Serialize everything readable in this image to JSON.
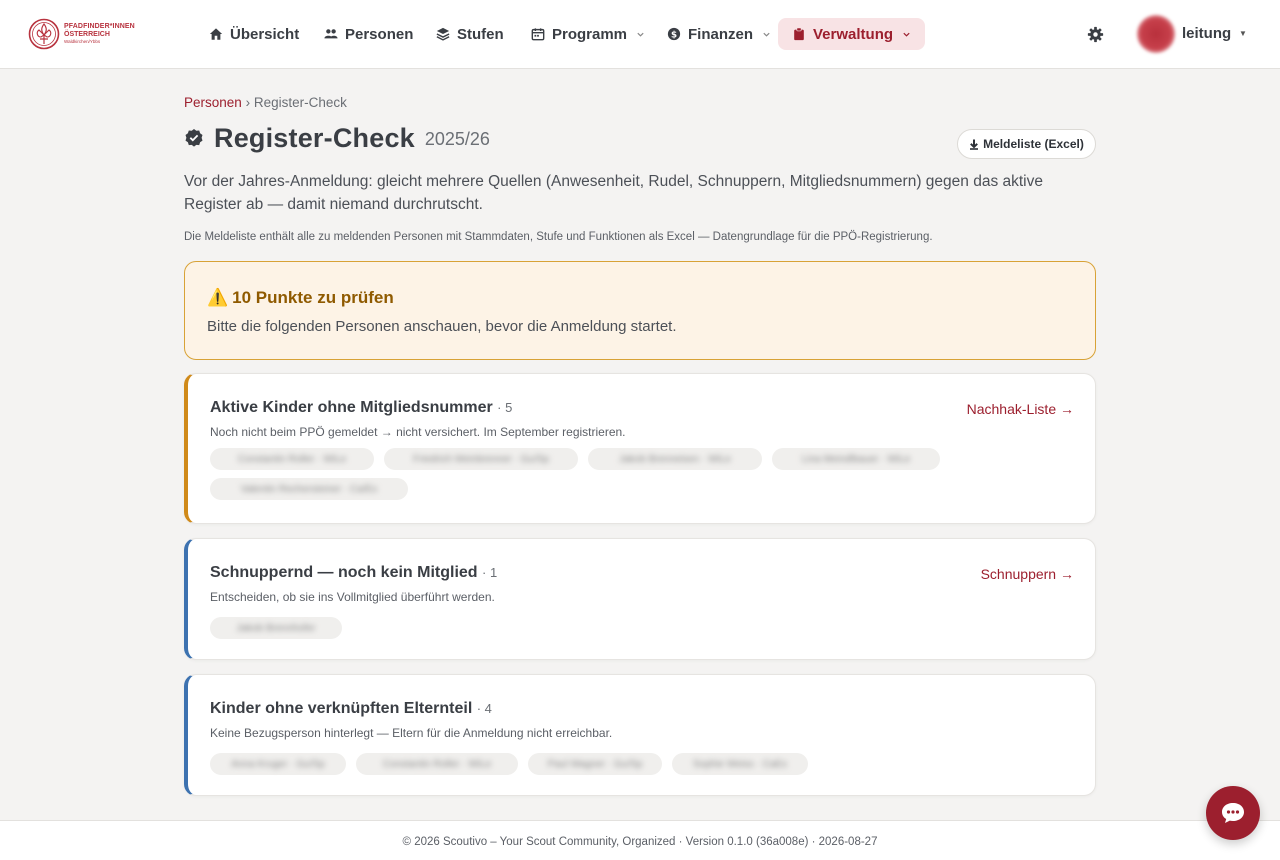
{
  "brand": {
    "line1": "PFADFINDER*INNEN",
    "line2": "ÖSTERREICH",
    "line3": "Waldkirchen/Ybbs",
    "color": "#b8333f"
  },
  "nav": {
    "items": [
      {
        "label": "Übersicht",
        "icon": "home-icon"
      },
      {
        "label": "Personen",
        "icon": "people-icon"
      },
      {
        "label": "Stufen",
        "icon": "layers-icon"
      },
      {
        "label": "Programm",
        "icon": "calendar-icon"
      },
      {
        "label": "Finanzen",
        "icon": "dollar-icon"
      },
      {
        "label": "Verwaltung",
        "icon": "clipboard-icon",
        "active": true
      }
    ],
    "user": "leitung",
    "accent": "#9c1f2e"
  },
  "breadcrumb": {
    "parent": "Personen",
    "separator": "›",
    "current": "Register-Check"
  },
  "page": {
    "title": "Register-Check",
    "year": "2025/26",
    "excel_button": "Meldeliste (Excel)",
    "intro": "Vor der Jahres-Anmeldung: gleicht mehrere Quellen (Anwesenheit, Rudel, Schnuppern, Mitgliedsnummern) gegen das aktive Register ab — damit niemand durchrutscht.",
    "note": "Die Meldeliste enthält alle zu meldenden Personen mit Stammdaten, Stufe und Funktionen als Excel — Datengrundlage für die PPÖ-Registrierung."
  },
  "alert": {
    "icon": "⚠️",
    "title": "10 Punkte zu prüfen",
    "text": "Bitte die folgenden Personen anschauen, bevor die Anmeldung startet."
  },
  "cards": [
    {
      "title": "Aktive Kinder ohne Mitgliedsnummer",
      "count": "· 5",
      "desc": "Noch nicht beim PPÖ gemeldet → nicht versichert. Im September registrieren.",
      "link": "Nachhak-Liste →",
      "accent": "#d08a1a",
      "chips": [
        "Constantin Roller · WiLe",
        "Friedrich Weinbrenner · Gu/Sp",
        "Jakob Brenneisen · WiLe",
        "Lina Meindlbauer · WiLe",
        "Valentin Rechersteiner · Ca/Ex"
      ]
    },
    {
      "title": "Schnuppernd — noch kein Mitglied",
      "count": "· 1",
      "desc": "Entscheiden, ob sie ins Vollmitglied überführt werden.",
      "link": "Schnuppern →",
      "accent": "#3d72b0",
      "chips": [
        "Jakob Brennhofer"
      ]
    },
    {
      "title": "Kinder ohne verknüpften Elternteil",
      "count": "· 4",
      "desc": "Keine Bezugsperson hinterlegt — Eltern für die Anmeldung nicht erreichbar.",
      "link": "",
      "accent": "#3d72b0",
      "chips": [
        "Anna Kruger · Gu/Sp",
        "Constantin Roller · WiLe",
        "Paul Wagner · Gu/Sp",
        "Sophie Weiss · CaEx"
      ]
    }
  ],
  "footer": "© 2026 Scoutivo – Your Scout Community, Organized · Version 0.1.0 (36a008e) · 2026-08-27"
}
